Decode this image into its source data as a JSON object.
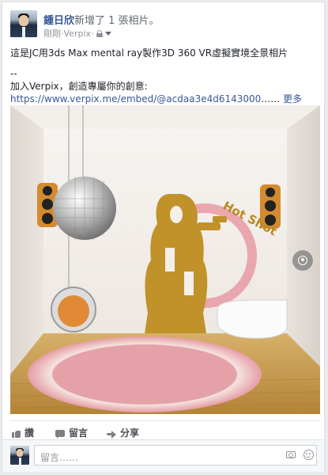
{
  "post": {
    "author": "鍾日欣",
    "action": "新增了 1 張相片。",
    "time": "剛剛",
    "separator": " · ",
    "app": "Verpix",
    "audience_separator": " · ",
    "lines": [
      "這是JC用3ds Max mental ray製作3D 360 VR虛擬實境全景相片",
      "--",
      "加入Verpix，創造專屬你的創意:"
    ],
    "link_text": "https://www.verpix.me/embed/@acdaa3e4d6143000",
    "ellipsis": "…… ",
    "more_label": "更多"
  },
  "photo": {
    "poster_text": "Hot Shot",
    "icon": "360-vr-icon"
  },
  "actions": {
    "like_label": "讚",
    "comment_label": "留言",
    "share_label": "分享"
  },
  "comment_box": {
    "placeholder": "留言……"
  },
  "icons": {
    "lock": "lock-icon",
    "caret": "chevron-down-icon",
    "like": "thumbs-up-icon",
    "comment": "comment-icon",
    "share": "share-icon",
    "camera": "camera-icon",
    "emoji": "emoji-icon"
  },
  "colors": {
    "link": "#365899",
    "meta": "#90949c",
    "wall": "#f4f1ee",
    "floor": "#c49a52",
    "poster": "#b8861b",
    "ring": "#e79aa6",
    "rug": "#e8b0b6"
  }
}
